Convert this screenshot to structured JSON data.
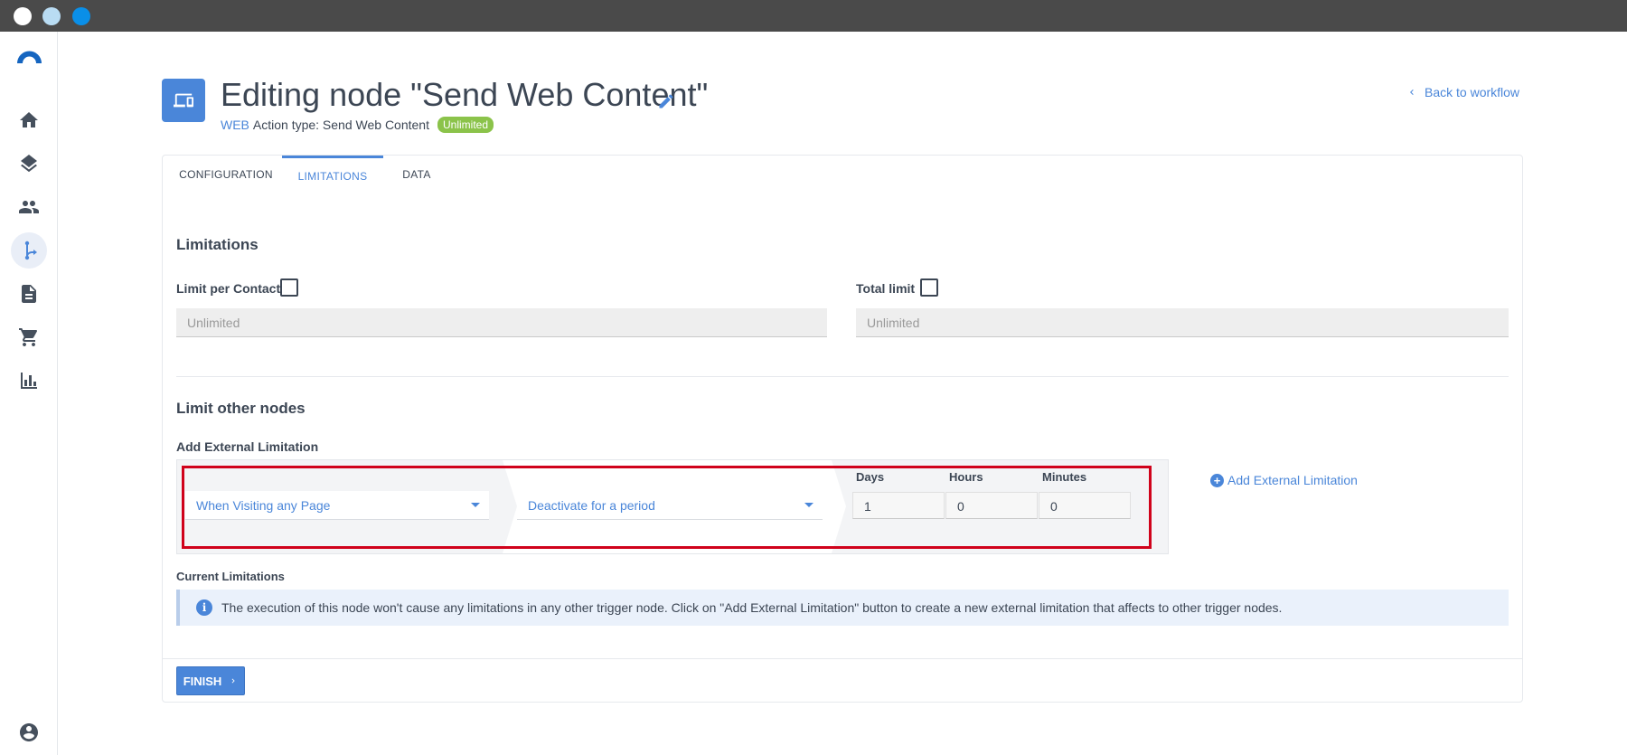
{
  "window": {
    "controls": [
      "close",
      "minimize",
      "maximize"
    ]
  },
  "sidebar": {
    "items": [
      {
        "icon": "home-icon"
      },
      {
        "icon": "layers-icon"
      },
      {
        "icon": "people-icon"
      },
      {
        "icon": "workflow-icon",
        "active": true
      },
      {
        "icon": "document-icon"
      },
      {
        "icon": "cart-icon"
      },
      {
        "icon": "chart-icon"
      },
      {
        "icon": "account-icon"
      }
    ]
  },
  "header": {
    "title": "Editing node \"Send Web Content\"",
    "channel": "WEB",
    "action_type": "Action type: Send Web Content",
    "badge": "Unlimited",
    "back_link": "Back to workflow"
  },
  "tabs": [
    {
      "label": "CONFIGURATION",
      "active": false
    },
    {
      "label": "LIMITATIONS",
      "active": true
    },
    {
      "label": "DATA",
      "active": false
    }
  ],
  "limitations": {
    "title": "Limitations",
    "per_contact_label": "Limit per Contact",
    "per_contact_checked": false,
    "per_contact_placeholder": "Unlimited",
    "total_label": "Total limit",
    "total_checked": false,
    "total_placeholder": "Unlimited"
  },
  "other_nodes": {
    "title": "Limit other nodes",
    "add_label": "Add External Limitation",
    "trigger_select": "When Visiting any Page",
    "action_select": "Deactivate for a period",
    "days_label": "Days",
    "days_value": "1",
    "hours_label": "Hours",
    "hours_value": "0",
    "minutes_label": "Minutes",
    "minutes_value": "0",
    "add_button": "Add External Limitation",
    "current_label": "Current Limitations",
    "info_text": "The execution of this node won't cause any limitations in any other trigger node. Click on \"Add External Limitation\" button to create a new external limitation that affects to other trigger nodes."
  },
  "footer": {
    "finish_label": "FINISH"
  },
  "colors": {
    "accent": "#4a86d9",
    "badge": "#8bc34a",
    "highlight": "#d0021b"
  }
}
